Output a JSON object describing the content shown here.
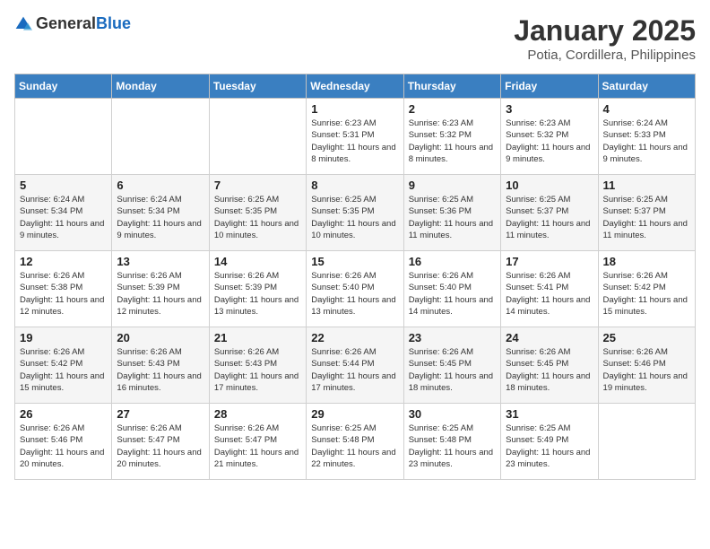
{
  "header": {
    "logo_general": "General",
    "logo_blue": "Blue",
    "month": "January 2025",
    "location": "Potia, Cordillera, Philippines"
  },
  "weekdays": [
    "Sunday",
    "Monday",
    "Tuesday",
    "Wednesday",
    "Thursday",
    "Friday",
    "Saturday"
  ],
  "weeks": [
    [
      {
        "day": "",
        "sunrise": "",
        "sunset": "",
        "daylight": ""
      },
      {
        "day": "",
        "sunrise": "",
        "sunset": "",
        "daylight": ""
      },
      {
        "day": "",
        "sunrise": "",
        "sunset": "",
        "daylight": ""
      },
      {
        "day": "1",
        "sunrise": "Sunrise: 6:23 AM",
        "sunset": "Sunset: 5:31 PM",
        "daylight": "Daylight: 11 hours and 8 minutes."
      },
      {
        "day": "2",
        "sunrise": "Sunrise: 6:23 AM",
        "sunset": "Sunset: 5:32 PM",
        "daylight": "Daylight: 11 hours and 8 minutes."
      },
      {
        "day": "3",
        "sunrise": "Sunrise: 6:23 AM",
        "sunset": "Sunset: 5:32 PM",
        "daylight": "Daylight: 11 hours and 9 minutes."
      },
      {
        "day": "4",
        "sunrise": "Sunrise: 6:24 AM",
        "sunset": "Sunset: 5:33 PM",
        "daylight": "Daylight: 11 hours and 9 minutes."
      }
    ],
    [
      {
        "day": "5",
        "sunrise": "Sunrise: 6:24 AM",
        "sunset": "Sunset: 5:34 PM",
        "daylight": "Daylight: 11 hours and 9 minutes."
      },
      {
        "day": "6",
        "sunrise": "Sunrise: 6:24 AM",
        "sunset": "Sunset: 5:34 PM",
        "daylight": "Daylight: 11 hours and 9 minutes."
      },
      {
        "day": "7",
        "sunrise": "Sunrise: 6:25 AM",
        "sunset": "Sunset: 5:35 PM",
        "daylight": "Daylight: 11 hours and 10 minutes."
      },
      {
        "day": "8",
        "sunrise": "Sunrise: 6:25 AM",
        "sunset": "Sunset: 5:35 PM",
        "daylight": "Daylight: 11 hours and 10 minutes."
      },
      {
        "day": "9",
        "sunrise": "Sunrise: 6:25 AM",
        "sunset": "Sunset: 5:36 PM",
        "daylight": "Daylight: 11 hours and 11 minutes."
      },
      {
        "day": "10",
        "sunrise": "Sunrise: 6:25 AM",
        "sunset": "Sunset: 5:37 PM",
        "daylight": "Daylight: 11 hours and 11 minutes."
      },
      {
        "day": "11",
        "sunrise": "Sunrise: 6:25 AM",
        "sunset": "Sunset: 5:37 PM",
        "daylight": "Daylight: 11 hours and 11 minutes."
      }
    ],
    [
      {
        "day": "12",
        "sunrise": "Sunrise: 6:26 AM",
        "sunset": "Sunset: 5:38 PM",
        "daylight": "Daylight: 11 hours and 12 minutes."
      },
      {
        "day": "13",
        "sunrise": "Sunrise: 6:26 AM",
        "sunset": "Sunset: 5:39 PM",
        "daylight": "Daylight: 11 hours and 12 minutes."
      },
      {
        "day": "14",
        "sunrise": "Sunrise: 6:26 AM",
        "sunset": "Sunset: 5:39 PM",
        "daylight": "Daylight: 11 hours and 13 minutes."
      },
      {
        "day": "15",
        "sunrise": "Sunrise: 6:26 AM",
        "sunset": "Sunset: 5:40 PM",
        "daylight": "Daylight: 11 hours and 13 minutes."
      },
      {
        "day": "16",
        "sunrise": "Sunrise: 6:26 AM",
        "sunset": "Sunset: 5:40 PM",
        "daylight": "Daylight: 11 hours and 14 minutes."
      },
      {
        "day": "17",
        "sunrise": "Sunrise: 6:26 AM",
        "sunset": "Sunset: 5:41 PM",
        "daylight": "Daylight: 11 hours and 14 minutes."
      },
      {
        "day": "18",
        "sunrise": "Sunrise: 6:26 AM",
        "sunset": "Sunset: 5:42 PM",
        "daylight": "Daylight: 11 hours and 15 minutes."
      }
    ],
    [
      {
        "day": "19",
        "sunrise": "Sunrise: 6:26 AM",
        "sunset": "Sunset: 5:42 PM",
        "daylight": "Daylight: 11 hours and 15 minutes."
      },
      {
        "day": "20",
        "sunrise": "Sunrise: 6:26 AM",
        "sunset": "Sunset: 5:43 PM",
        "daylight": "Daylight: 11 hours and 16 minutes."
      },
      {
        "day": "21",
        "sunrise": "Sunrise: 6:26 AM",
        "sunset": "Sunset: 5:43 PM",
        "daylight": "Daylight: 11 hours and 17 minutes."
      },
      {
        "day": "22",
        "sunrise": "Sunrise: 6:26 AM",
        "sunset": "Sunset: 5:44 PM",
        "daylight": "Daylight: 11 hours and 17 minutes."
      },
      {
        "day": "23",
        "sunrise": "Sunrise: 6:26 AM",
        "sunset": "Sunset: 5:45 PM",
        "daylight": "Daylight: 11 hours and 18 minutes."
      },
      {
        "day": "24",
        "sunrise": "Sunrise: 6:26 AM",
        "sunset": "Sunset: 5:45 PM",
        "daylight": "Daylight: 11 hours and 18 minutes."
      },
      {
        "day": "25",
        "sunrise": "Sunrise: 6:26 AM",
        "sunset": "Sunset: 5:46 PM",
        "daylight": "Daylight: 11 hours and 19 minutes."
      }
    ],
    [
      {
        "day": "26",
        "sunrise": "Sunrise: 6:26 AM",
        "sunset": "Sunset: 5:46 PM",
        "daylight": "Daylight: 11 hours and 20 minutes."
      },
      {
        "day": "27",
        "sunrise": "Sunrise: 6:26 AM",
        "sunset": "Sunset: 5:47 PM",
        "daylight": "Daylight: 11 hours and 20 minutes."
      },
      {
        "day": "28",
        "sunrise": "Sunrise: 6:26 AM",
        "sunset": "Sunset: 5:47 PM",
        "daylight": "Daylight: 11 hours and 21 minutes."
      },
      {
        "day": "29",
        "sunrise": "Sunrise: 6:25 AM",
        "sunset": "Sunset: 5:48 PM",
        "daylight": "Daylight: 11 hours and 22 minutes."
      },
      {
        "day": "30",
        "sunrise": "Sunrise: 6:25 AM",
        "sunset": "Sunset: 5:48 PM",
        "daylight": "Daylight: 11 hours and 23 minutes."
      },
      {
        "day": "31",
        "sunrise": "Sunrise: 6:25 AM",
        "sunset": "Sunset: 5:49 PM",
        "daylight": "Daylight: 11 hours and 23 minutes."
      },
      {
        "day": "",
        "sunrise": "",
        "sunset": "",
        "daylight": ""
      }
    ]
  ]
}
